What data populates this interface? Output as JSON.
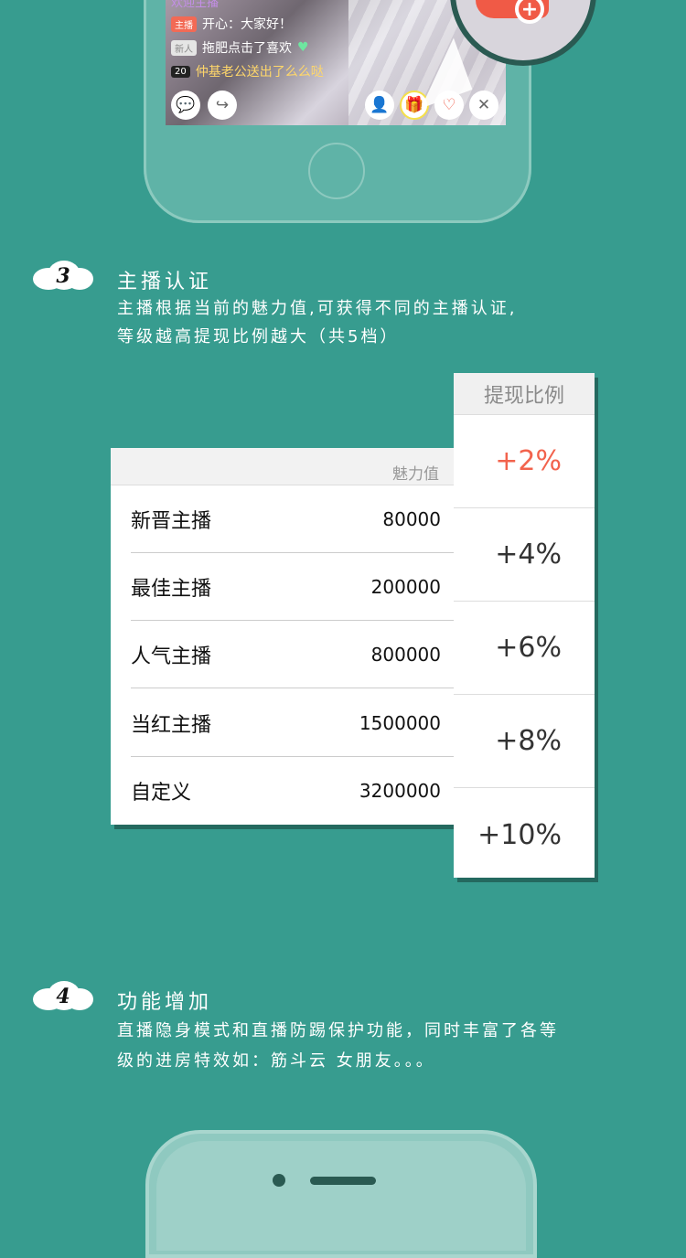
{
  "top_phone": {
    "chat_header": "欢迎主播",
    "chat": [
      {
        "tag": "主播",
        "text": "开心：大家好！"
      },
      {
        "tag": "新人",
        "text": "拖肥点击了喜欢"
      },
      {
        "tag": "20",
        "text": "仲基老公送出了么么哒"
      }
    ]
  },
  "section3": {
    "number": "3",
    "title": "主播认证",
    "desc_line1": "主播根据当前的魅力值,可获得不同的主播认证,",
    "desc_line2": "等级越高提现比例越大（共5档）"
  },
  "table": {
    "charm_header": "魅力值",
    "ratio_header": "提现比例",
    "rows": [
      {
        "name": "新晋主播",
        "value": "80000"
      },
      {
        "name": "最佳主播",
        "value": "200000"
      },
      {
        "name": "人气主播",
        "value": "800000"
      },
      {
        "name": "当红主播",
        "value": "1500000"
      },
      {
        "name": "自定义",
        "value": "3200000"
      }
    ],
    "ratios": [
      "+2%",
      "+4%",
      "+6%",
      "+8%",
      "+10%"
    ]
  },
  "section4": {
    "number": "4",
    "title": "功能增加",
    "desc_line1": "直播隐身模式和直播防踢保护功能，同时丰富了各等",
    "desc_line2": "级的进房特效如：筋斗云 女朋友。。。"
  },
  "colors": {
    "background": "#379c8f",
    "highlight": "#f2634d"
  }
}
